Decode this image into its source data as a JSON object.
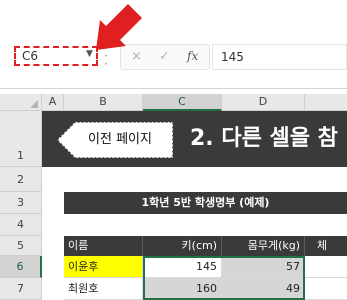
{
  "formula_bar": {
    "name_box": "C6",
    "cancel_icon": "×",
    "enter_icon": "✓",
    "fx_label": "fx",
    "value": "145"
  },
  "columns": [
    "A",
    "B",
    "C",
    "D"
  ],
  "rows": [
    "1",
    "2",
    "3",
    "4",
    "5",
    "6",
    "7"
  ],
  "sheet": {
    "prev_button": "이전 페이지",
    "title": "2. 다른 셀을 참",
    "table_title": "1학년 5반 학생명부 (예제)",
    "headers": [
      "이름",
      "키(cm)",
      "몸무게(kg)",
      "체"
    ],
    "data_rows": [
      {
        "name": "이윤후",
        "height": "145",
        "weight": "57"
      },
      {
        "name": "최원호",
        "height": "160",
        "weight": "49"
      }
    ]
  },
  "colors": {
    "accent": "#217346",
    "highlight": "#ffff00",
    "callout": "#e02020",
    "dark": "#3a3a3a"
  }
}
